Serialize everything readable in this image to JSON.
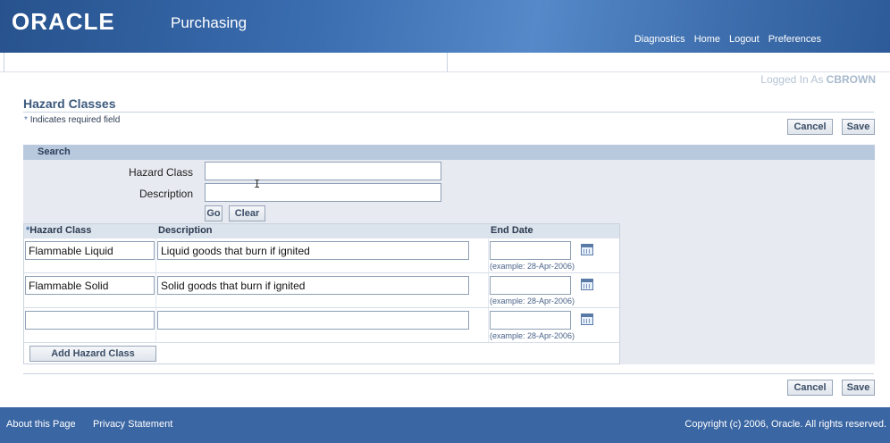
{
  "header": {
    "logo": "ORACLE",
    "app_title": "Purchasing",
    "links": [
      "Diagnostics",
      "Home",
      "Logout",
      "Preferences"
    ]
  },
  "user": {
    "logged_in_prefix": "Logged In As",
    "username": "CBROWN"
  },
  "page": {
    "title": "Hazard Classes",
    "required_note": "Indicates required field",
    "required_symbol": "*"
  },
  "buttons": {
    "cancel": "Cancel",
    "save": "Save",
    "go": "Go",
    "clear": "Clear",
    "add": "Add Hazard Class"
  },
  "search": {
    "heading": "Search",
    "hazard_class_label": "Hazard Class",
    "description_label": "Description",
    "hazard_class_value": "",
    "description_value": ""
  },
  "table": {
    "columns": [
      "Hazard Class",
      "Description",
      "End Date"
    ],
    "rows": [
      {
        "hazard_class": "Flammable Liquid",
        "description": "Liquid goods that burn if ignited",
        "end_date": "",
        "example": "(example: 28-Apr-2006)"
      },
      {
        "hazard_class": "Flammable Solid",
        "description": "Solid goods that burn if ignited",
        "end_date": "",
        "example": "(example: 28-Apr-2006)"
      },
      {
        "hazard_class": "",
        "description": "",
        "end_date": "",
        "example": "(example: 28-Apr-2006)"
      }
    ]
  },
  "footer": {
    "about": "About this Page",
    "privacy": "Privacy Statement",
    "copyright": "Copyright (c) 2006, Oracle. All rights reserved."
  },
  "colors": {
    "header_blue": "#3a6db0",
    "footer_blue": "#3a66a3",
    "title_blue": "#3c5a7e"
  },
  "icons": [
    "calendar-icon"
  ]
}
